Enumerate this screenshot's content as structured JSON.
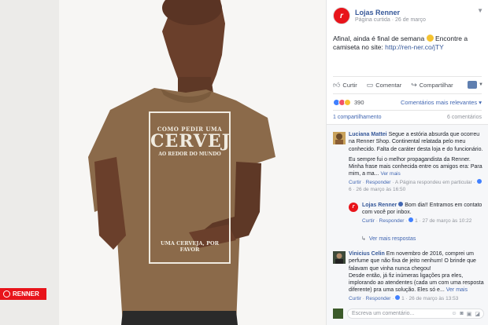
{
  "photo": {
    "shirt_print": {
      "top": "COMO PEDIR UMA",
      "big": "CERVEJA",
      "sub": "AO REDOR DO MUNDO",
      "bottom": "UMA CERVEJA, POR FAVOR"
    },
    "brand_badge": "RENNER"
  },
  "post": {
    "page_name": "Lojas Renner",
    "page_type": "Página curtida",
    "date": "26 de março",
    "text": "Afinal, ainda é final de semana",
    "text_2": " Encontre a camiseta no site: ",
    "link": "http://ren-ner.co/jTY",
    "actions": {
      "like": "Curtir",
      "comment": "Comentar",
      "share": "Compartilhar"
    },
    "reactions_count": "390",
    "sort_label": "Comentários mais relevantes",
    "shares": "1 compartilhamento",
    "comments_count": "6 comentários"
  },
  "comments": [
    {
      "name": "Luciana Mattei",
      "text": "Segue a estória absurda que ocorreu na Renner Shop. Continental relatada pelo meu conhecido. Falta de caráter desta loja e do funcionário.",
      "text_2": "Eu sempre fui o melhor propagandista da Renner. Minha frase mais conhecida entre os amigos era: Para mim, a ma...",
      "see_more": "Ver mais",
      "reply_like": "Curtir",
      "reply_reply": "Responder",
      "reply_note": "A Página respondeu em particular",
      "reactions": "6",
      "time": "26 de março às 16:50"
    },
    {
      "name": "Lojas Renner",
      "text": "Bom dia!! Entramos em contato com você por inbox.",
      "reply_like": "Curtir",
      "reply_reply": "Responder",
      "reactions": "1",
      "time": "27 de março às 10:22"
    },
    {
      "name": "Vinicius Celin",
      "text": "Em novembro de 2016, comprei um perfume que não fixa de jeito nenhum! O brinde que falavam que vinha nunca chegou!",
      "text_2": "Desde então, já fiz inúmeras ligações pra eles, implorando ao atendentes (cada um com uma resposta diferente) pra uma solução. Eles só e...",
      "see_more": "Ver mais",
      "reply_like": "Curtir",
      "reply_reply": "Responder",
      "reactions": "1",
      "time": "26 de março às 13:53"
    }
  ],
  "more_replies": "Ver mais respostas",
  "comment_placeholder": "Escreva um comentário..."
}
